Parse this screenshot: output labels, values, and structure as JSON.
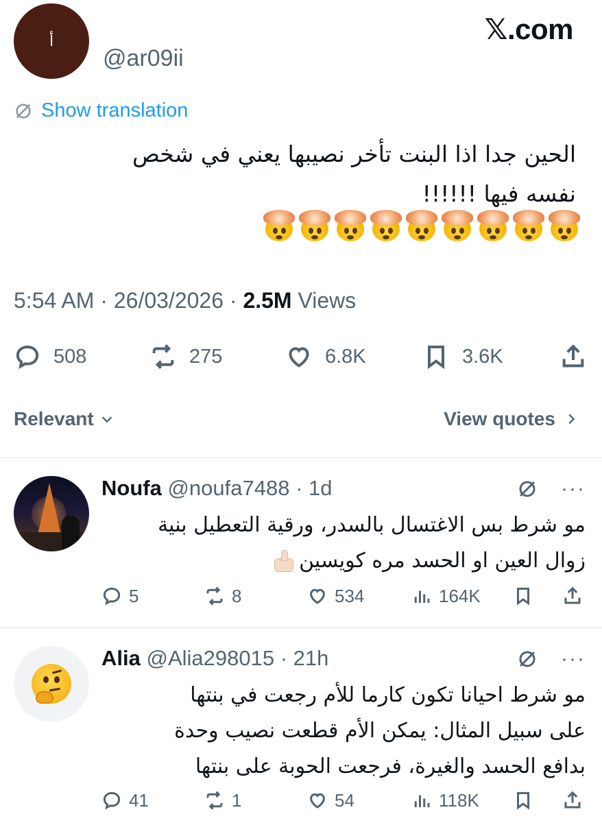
{
  "brand": "𝕏.com",
  "main_tweet": {
    "avatar_letter": "أ",
    "handle": "@ar09ii",
    "translation_label": "Show translation",
    "text_lines": [
      "الحين جدا اذا البنت تأخر نصيبها يعني في  شخص",
      "نفسه فيها !!!!!!"
    ],
    "emoji_name": "exploding-head",
    "emoji_count": 9,
    "time": "5:54 AM",
    "date": "26/03/2026",
    "views_count": "2.5M",
    "views_label": "Views",
    "replies": "508",
    "reposts": "275",
    "likes": "6.8K",
    "bookmarks": "3.6K"
  },
  "sort": {
    "label": "Relevant",
    "view_quotes": "View quotes"
  },
  "replies": [
    {
      "name": "Noufa",
      "handle": "@noufa7488",
      "time": "1d",
      "text_lines": [
        "مو شرط بس الاغتسال بالسدر، ورقية التعطيل بنية",
        "زوال العين او الحسد مره كويسين"
      ],
      "replies": "5",
      "reposts": "8",
      "likes": "534",
      "views": "164K"
    },
    {
      "name": "Alia",
      "handle": "@Alia298015",
      "time": "21h",
      "text_lines": [
        "مو شرط احيانا تكون كارما للأم رجعت في بنتها",
        "على سبيل المثال: يمكن الأم قطعت نصيب وحدة",
        "بدافع الحسد والغيرة، فرجعت الحوبة على بنتها"
      ],
      "replies": "41",
      "reposts": "1",
      "likes": "54",
      "views": "118K"
    }
  ],
  "colors": {
    "link": "#1d9bf0",
    "secondary_text": "#536471",
    "primary_text": "#0f1419",
    "divider": "#eff3f4"
  }
}
